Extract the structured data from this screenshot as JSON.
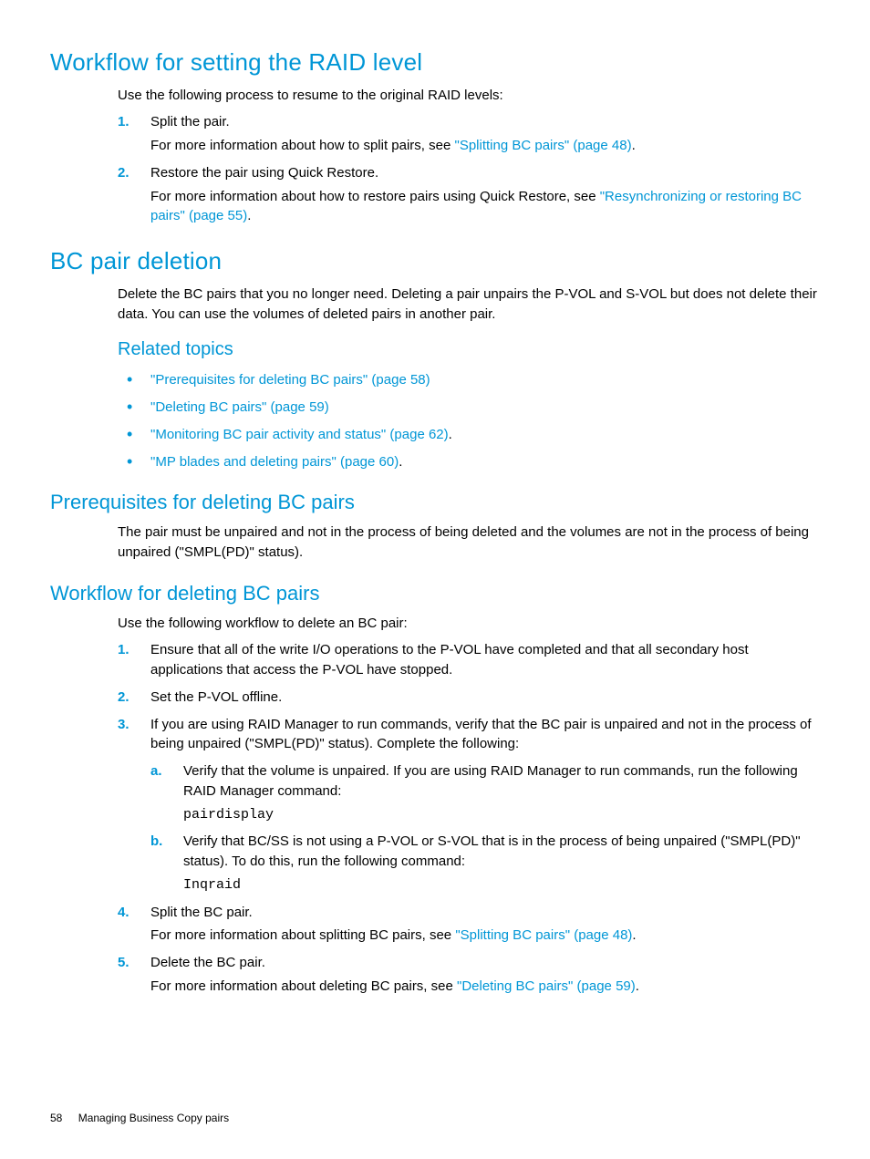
{
  "section1": {
    "title": "Workflow for setting the RAID level",
    "intro": "Use the following process to resume to the original RAID levels:",
    "steps": [
      {
        "text": "Split the pair.",
        "more_pre": "For more information about how to split pairs, see ",
        "link": "\"Splitting BC pairs\" (page 48)",
        "more_post": "."
      },
      {
        "text": "Restore the pair using Quick Restore.",
        "more_pre": "For more information about how to restore pairs using Quick Restore, see ",
        "link": "\"Resynchronizing or restoring BC pairs\" (page 55)",
        "more_post": "."
      }
    ]
  },
  "section2": {
    "title": "BC pair deletion",
    "intro": "Delete the BC pairs that you no longer need. Deleting a pair unpairs the P-VOL and S-VOL but does not delete their data. You can use the volumes of deleted pairs in another pair.",
    "related_heading": "Related topics",
    "related": [
      {
        "link": "\"Prerequisites for deleting BC pairs\" (page 58)",
        "post": ""
      },
      {
        "link": "\"Deleting BC pairs\" (page 59)",
        "post": ""
      },
      {
        "link": "\"Monitoring BC pair activity and status\" (page 62)",
        "post": "."
      },
      {
        "link": "\"MP blades and deleting pairs\" (page 60)",
        "post": "."
      }
    ]
  },
  "section3": {
    "title": "Prerequisites for deleting BC pairs",
    "text": "The pair must be unpaired and not in the process of being deleted and the volumes are not in the process of being unpaired (\"SMPL(PD)\" status)."
  },
  "section4": {
    "title": "Workflow for deleting BC pairs",
    "intro": "Use the following workflow to delete an BC pair:",
    "steps": {
      "s1": "Ensure that all of the write I/O operations to the P-VOL have completed and that all secondary host applications that access the P-VOL have stopped.",
      "s2": "Set the P-VOL offline.",
      "s3": {
        "text": "If you are using RAID Manager to run commands, verify that the BC pair is unpaired and not in the process of being unpaired (\"SMPL(PD)\" status). Complete the following:",
        "a": {
          "text": "Verify that the volume is unpaired. If you are using RAID Manager to run commands, run the following RAID Manager command:",
          "code": "pairdisplay"
        },
        "b": {
          "text": "Verify that BC/SS is not using a P-VOL or S-VOL that is in the process of being unpaired (\"SMPL(PD)\" status). To do this, run the following command:",
          "code": "Inqraid"
        }
      },
      "s4": {
        "text": "Split the BC pair.",
        "more_pre": "For more information about splitting BC pairs, see ",
        "link": "\"Splitting BC pairs\" (page 48)",
        "more_post": "."
      },
      "s5": {
        "text": "Delete the BC pair.",
        "more_pre": "For more information about deleting BC pairs, see ",
        "link": "\"Deleting BC pairs\" (page 59)",
        "more_post": "."
      }
    }
  },
  "footer": {
    "page": "58",
    "title": "Managing Business Copy pairs"
  }
}
